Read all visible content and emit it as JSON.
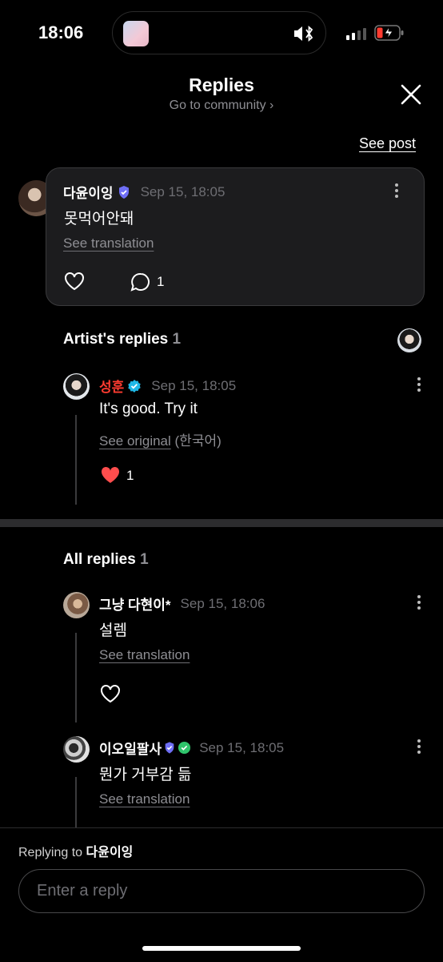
{
  "status": {
    "time": "18:06"
  },
  "header": {
    "title": "Replies",
    "subtitle": "Go to community ›",
    "see_post": "See post"
  },
  "post": {
    "author": "다윤이잉",
    "time": "Sep 15, 18:05",
    "text": "못먹어안돼",
    "translate": "See translation",
    "reply_count": "1"
  },
  "artist_section": {
    "title": "Artist's replies",
    "count": "1"
  },
  "artist_reply": {
    "author": "성훈",
    "author_color": "#ff3b30",
    "time": "Sep 15, 18:05",
    "text": "It's good. Try it",
    "see_original": "See original",
    "original_lang": "(한국어)",
    "like_count": "1"
  },
  "all_section": {
    "title": "All replies",
    "count": "1"
  },
  "replies": [
    {
      "author": "그냥 다현이*",
      "time": "Sep 15, 18:06",
      "text": "설렘",
      "translate": "See translation"
    },
    {
      "author": "이오일팔사",
      "time": "Sep 15, 18:05",
      "text": "뭔가 거부감 듦",
      "translate": "See translation"
    }
  ],
  "composer": {
    "replying_prefix": "Replying to",
    "replying_to": "다윤이잉",
    "placeholder": "Enter a reply"
  }
}
